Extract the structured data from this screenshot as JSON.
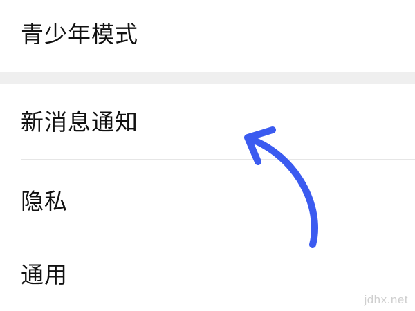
{
  "settings": {
    "items": [
      {
        "label": "青少年模式"
      },
      {
        "label": "新消息通知"
      },
      {
        "label": "隐私"
      },
      {
        "label": "通用"
      }
    ]
  },
  "annotation": {
    "icon": "curved-arrow-icon",
    "color": "#3b5bf0"
  },
  "watermark": {
    "text": "jdhx.net"
  },
  "colors": {
    "background": "#ffffff",
    "section_gap": "#efefef",
    "divider": "#e6e6e6",
    "text": "#111111"
  }
}
